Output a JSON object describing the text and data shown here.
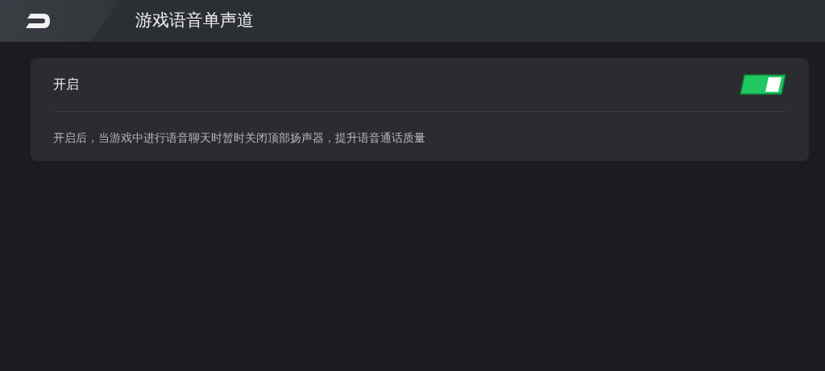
{
  "header": {
    "title": "游戏语音单声道"
  },
  "setting": {
    "label": "开启",
    "on": true,
    "description": "开启后，当游戏中进行语音聊天时暂时关闭顶部扬声器，提升语音通话质量"
  }
}
